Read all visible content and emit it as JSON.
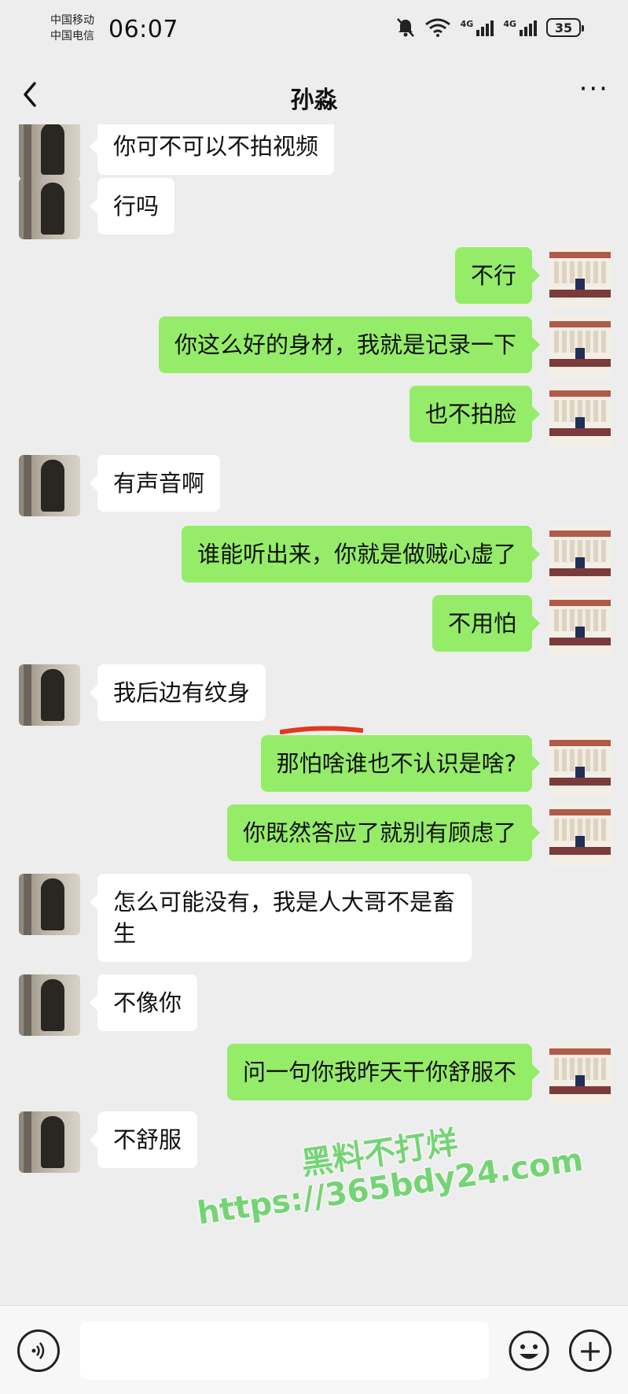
{
  "status_bar": {
    "carrier_1": "中国移动",
    "carrier_2": "中国电信",
    "time": "06:07",
    "battery": "35",
    "signal_label": "4G",
    "wifi_label": "6"
  },
  "header": {
    "title": "孙淼",
    "more_label": "···"
  },
  "messages": [
    {
      "side": "in",
      "text": "你可不可以不拍视频"
    },
    {
      "side": "in",
      "text": "行吗"
    },
    {
      "side": "out",
      "text": "不行"
    },
    {
      "side": "out",
      "text": "你这么好的身材，我就是记录一下"
    },
    {
      "side": "out",
      "text": "也不拍脸"
    },
    {
      "side": "in",
      "text": "有声音啊"
    },
    {
      "side": "out",
      "text": "谁能听出来，你就是做贼心虚了"
    },
    {
      "side": "out",
      "text": "不用怕"
    },
    {
      "side": "in",
      "text": "我后边有纹身"
    },
    {
      "side": "out",
      "text": "那怕啥谁也不认识是啥?"
    },
    {
      "side": "out",
      "text": "你既然答应了就别有顾虑了"
    },
    {
      "side": "in",
      "text": "怎么可能没有，我是人大哥不是畜生"
    },
    {
      "side": "in",
      "text": "不像你"
    },
    {
      "side": "out",
      "text": "问一句你我昨天干你舒服不"
    },
    {
      "side": "in",
      "text": "不舒服"
    }
  ],
  "watermark": {
    "line1": "黑料不打烊",
    "line2": "https://365bdy24.com"
  },
  "input_bar": {
    "placeholder": ""
  },
  "colors": {
    "background": "#ededed",
    "bubble_out": "#95ec69",
    "bubble_in": "#ffffff",
    "annotation_red": "#e0391f"
  }
}
